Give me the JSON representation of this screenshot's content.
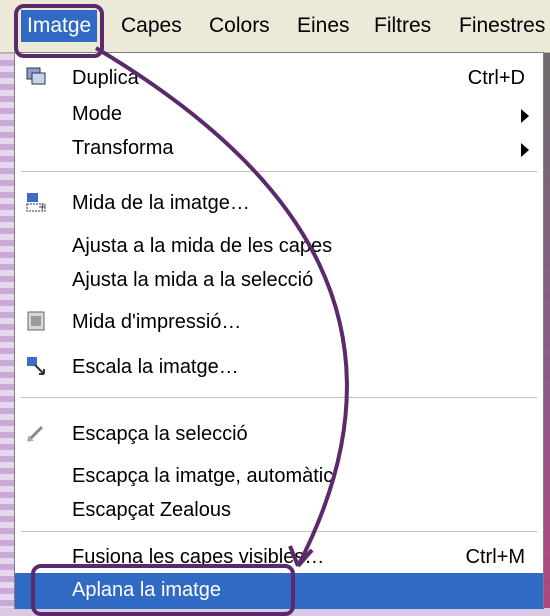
{
  "menubar": {
    "items": [
      "Imatge",
      "Capes",
      "Colors",
      "Eines",
      "Filtres",
      "Finestres"
    ]
  },
  "menu": {
    "items": [
      {
        "label": "Duplica",
        "shortcut": "Ctrl+D",
        "icon": "duplicate-icon"
      },
      {
        "label": "Mode",
        "submenu": true
      },
      {
        "label": "Transforma",
        "submenu": true
      },
      {
        "label": "Mida de la imatge…",
        "icon": "canvas-size-icon"
      },
      {
        "label": "Ajusta a la mida de les capes"
      },
      {
        "label": "Ajusta la mida a la selecció"
      },
      {
        "label": "Mida d'impressió…",
        "icon": "print-size-icon"
      },
      {
        "label": "Escala la imatge…",
        "icon": "scale-icon"
      },
      {
        "label": "Escapça la selecció",
        "icon": "crop-icon"
      },
      {
        "label": "Escapça la imatge, automàtic"
      },
      {
        "label": "Escapçat Zealous"
      },
      {
        "label": "Fusiona les capes visibles…",
        "shortcut": "Ctrl+M"
      },
      {
        "label": "Aplana la imatge",
        "selected": true
      }
    ]
  },
  "colors": {
    "highlight": "#316ac5",
    "annotation": "#5b2a6a"
  }
}
